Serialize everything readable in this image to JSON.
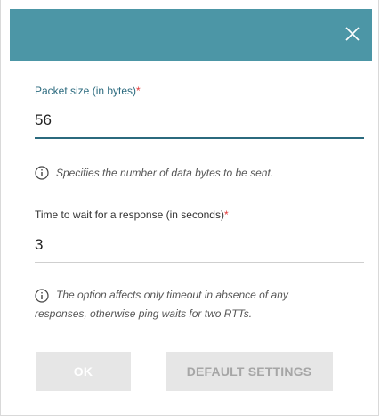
{
  "dialog": {
    "close_icon": "close-icon",
    "header_color": "#4c96a6"
  },
  "packet_size": {
    "label": "Packet size (in bytes)",
    "required_mark": "*",
    "value": "56",
    "hint": "Specifies the number of data bytes to be sent."
  },
  "timeout": {
    "label": "Time to wait for a response (in seconds)",
    "required_mark": "*",
    "value": "3",
    "hint_line1": "The option affects only timeout in absence of any",
    "hint_line2": "responses, otherwise ping waits for two RTTs."
  },
  "buttons": {
    "ok": "OK",
    "default_settings": "DEFAULT SETTINGS"
  },
  "colors": {
    "accent": "#2b6a7e",
    "required": "#e23b3b"
  }
}
